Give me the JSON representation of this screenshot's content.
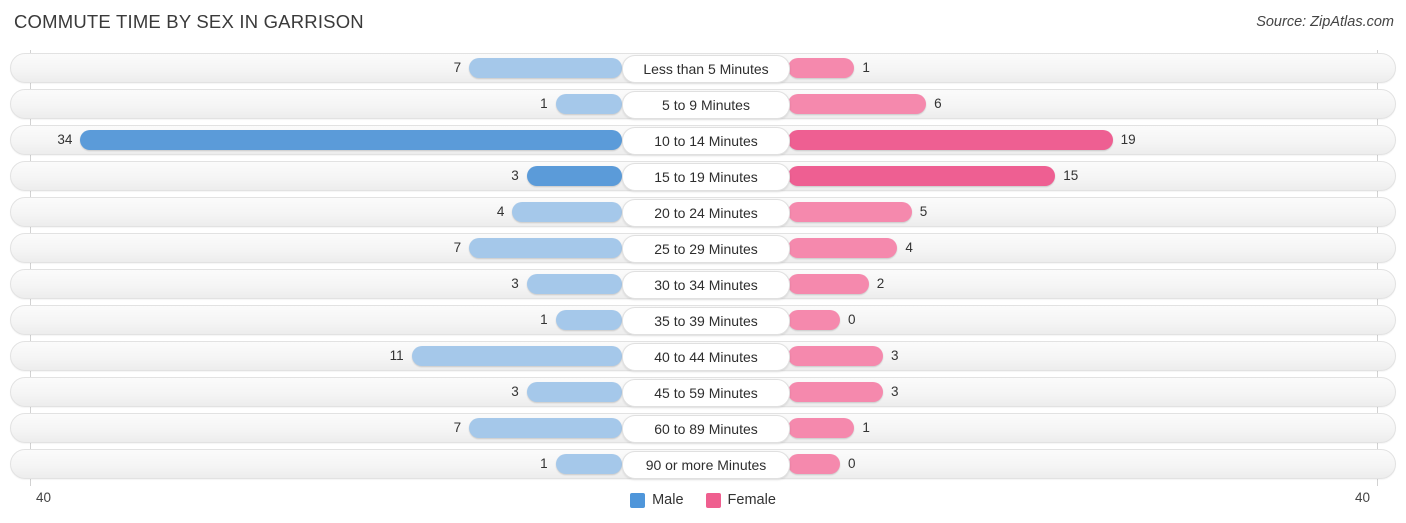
{
  "header": {
    "title": "COMMUTE TIME BY SEX IN GARRISON",
    "source": "Source: ZipAtlas.com"
  },
  "legend": {
    "items": [
      {
        "label": "Male",
        "color": "#4f96da"
      },
      {
        "label": "Female",
        "color": "#ef5f8f"
      }
    ]
  },
  "axis": {
    "left_tick": "40",
    "right_tick": "40",
    "max": 40
  },
  "colors": {
    "male": "#a5c8ea",
    "female": "#f589ad",
    "male_highlight": "#5b9bd9",
    "female_highlight": "#ee5f92"
  },
  "chart_data": {
    "type": "bar",
    "title": "COMMUTE TIME BY SEX IN GARRISON",
    "subtitle": "Source: ZipAtlas.com",
    "orientation": "horizontal-diverging",
    "xlabel": "",
    "ylabel": "",
    "xlim": [
      40,
      40
    ],
    "grid": false,
    "legend_position": "bottom-center",
    "categories": [
      "Less than 5 Minutes",
      "5 to 9 Minutes",
      "10 to 14 Minutes",
      "15 to 19 Minutes",
      "20 to 24 Minutes",
      "25 to 29 Minutes",
      "30 to 34 Minutes",
      "35 to 39 Minutes",
      "40 to 44 Minutes",
      "45 to 59 Minutes",
      "60 to 89 Minutes",
      "90 or more Minutes"
    ],
    "series": [
      {
        "name": "Male",
        "direction": "left",
        "values": [
          7,
          1,
          34,
          3,
          4,
          7,
          3,
          1,
          11,
          3,
          7,
          1
        ]
      },
      {
        "name": "Female",
        "direction": "right",
        "values": [
          1,
          6,
          19,
          15,
          5,
          4,
          2,
          0,
          3,
          3,
          1,
          0
        ]
      }
    ],
    "highlighted_rows": [
      2,
      3
    ]
  },
  "rows": [
    {
      "label": "Less than 5 Minutes",
      "male": "7",
      "female": "1",
      "male_val": 7,
      "female_val": 1,
      "highlight": false
    },
    {
      "label": "5 to 9 Minutes",
      "male": "1",
      "female": "6",
      "male_val": 1,
      "female_val": 6,
      "highlight": false
    },
    {
      "label": "10 to 14 Minutes",
      "male": "34",
      "female": "19",
      "male_val": 34,
      "female_val": 19,
      "highlight": true
    },
    {
      "label": "15 to 19 Minutes",
      "male": "3",
      "female": "15",
      "male_val": 3,
      "female_val": 15,
      "highlight": true
    },
    {
      "label": "20 to 24 Minutes",
      "male": "4",
      "female": "5",
      "male_val": 4,
      "female_val": 5,
      "highlight": false
    },
    {
      "label": "25 to 29 Minutes",
      "male": "7",
      "female": "4",
      "male_val": 7,
      "female_val": 4,
      "highlight": false
    },
    {
      "label": "30 to 34 Minutes",
      "male": "3",
      "female": "2",
      "male_val": 3,
      "female_val": 2,
      "highlight": false
    },
    {
      "label": "35 to 39 Minutes",
      "male": "1",
      "female": "0",
      "male_val": 1,
      "female_val": 0,
      "highlight": false
    },
    {
      "label": "40 to 44 Minutes",
      "male": "11",
      "female": "3",
      "male_val": 11,
      "female_val": 3,
      "highlight": false
    },
    {
      "label": "45 to 59 Minutes",
      "male": "3",
      "female": "3",
      "male_val": 3,
      "female_val": 3,
      "highlight": false
    },
    {
      "label": "60 to 89 Minutes",
      "male": "7",
      "female": "1",
      "male_val": 7,
      "female_val": 1,
      "highlight": false
    },
    {
      "label": "90 or more Minutes",
      "male": "1",
      "female": "0",
      "male_val": 1,
      "female_val": 0,
      "highlight": false
    }
  ]
}
